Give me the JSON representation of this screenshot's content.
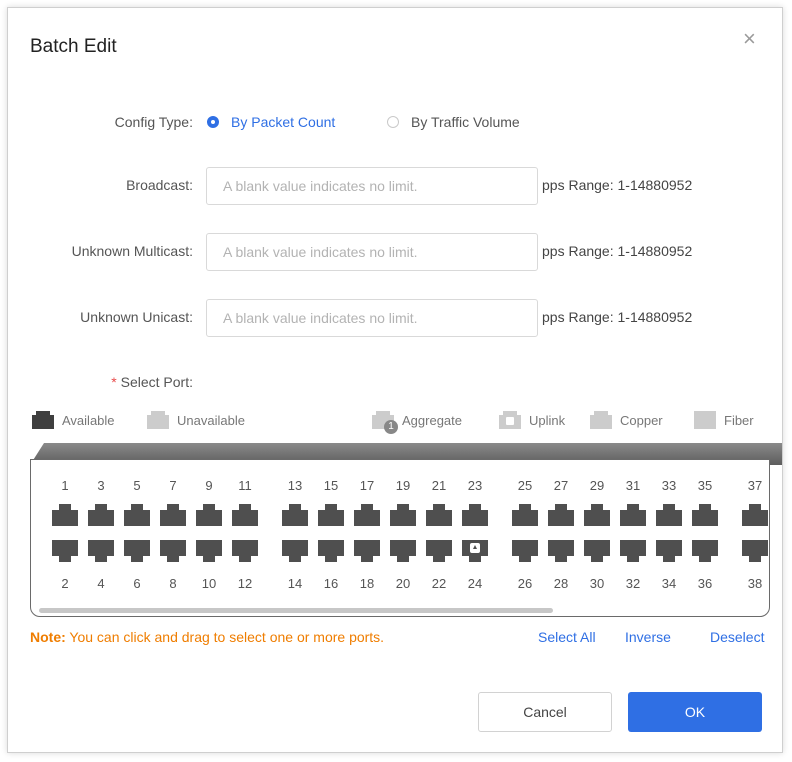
{
  "dialog": {
    "title": "Batch Edit",
    "close_glyph": "×"
  },
  "config_type": {
    "label": "Config Type:",
    "options": [
      "By Packet Count",
      "By Traffic Volume"
    ],
    "selected": "By Packet Count"
  },
  "fields": [
    {
      "label": "Broadcast:",
      "value": "",
      "placeholder": "A blank value indicates no limit.",
      "hint": "pps Range: 1-14880952"
    },
    {
      "label": "Unknown Multicast:",
      "value": "",
      "placeholder": "A blank value indicates no limit.",
      "hint": "pps Range: 1-14880952"
    },
    {
      "label": "Unknown Unicast:",
      "value": "",
      "placeholder": "A blank value indicates no limit.",
      "hint": "pps Range: 1-14880952"
    }
  ],
  "select_port": {
    "required_mark": "*",
    "label": "Select Port:"
  },
  "legend": {
    "available": "Available",
    "unavailable": "Unavailable",
    "aggregate": "Aggregate",
    "aggregate_badge": "1",
    "uplink": "Uplink",
    "copper": "Copper",
    "fiber": "Fiber"
  },
  "ports": {
    "top_row": [
      "1",
      "3",
      "5",
      "7",
      "9",
      "11",
      "13",
      "15",
      "17",
      "19",
      "21",
      "23",
      "25",
      "27",
      "29",
      "31",
      "33",
      "35",
      "37"
    ],
    "bottom_row": [
      "2",
      "4",
      "6",
      "8",
      "10",
      "12",
      "14",
      "16",
      "18",
      "20",
      "22",
      "24",
      "26",
      "28",
      "30",
      "32",
      "34",
      "36",
      "38"
    ],
    "uplink_port": "24"
  },
  "note": {
    "prefix": "Note:",
    "text": " You can click and drag to select one or more ports."
  },
  "actions": {
    "select_all": "Select All",
    "inverse": "Inverse",
    "deselect": "Deselect"
  },
  "buttons": {
    "cancel": "Cancel",
    "ok": "OK"
  },
  "colors": {
    "accent": "#2f6fe4",
    "note": "#ef7d00",
    "port_available": "#4f4f4f",
    "port_unavailable": "#cccccc",
    "required": "#e84a4a"
  }
}
